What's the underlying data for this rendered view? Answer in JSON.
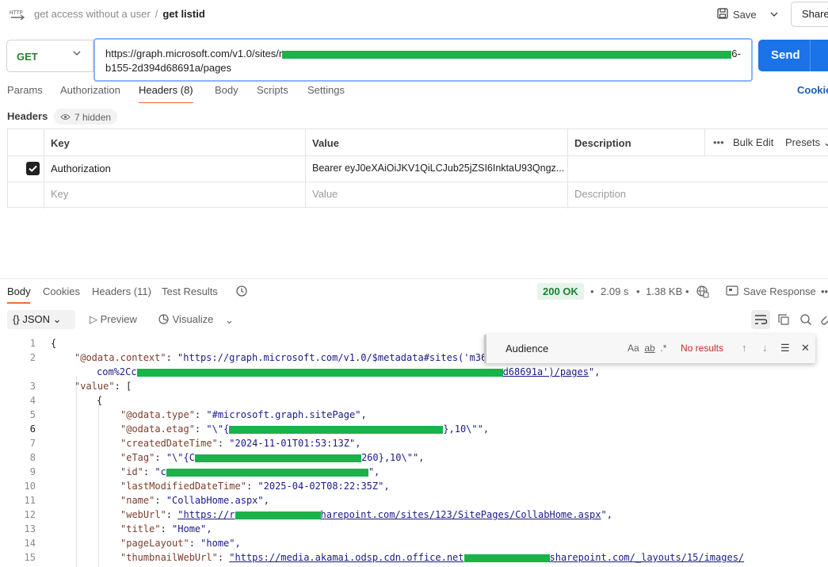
{
  "breadcrumb": {
    "parent": "get access without a user",
    "separator": "/",
    "current": "get listid"
  },
  "toolbar": {
    "save_label": "Save",
    "share_label": "Share"
  },
  "request": {
    "method": "GET",
    "url_line1_start": "https://graph.microsoft.com/v1.0/sites/r",
    "url_line1_end": "6-",
    "url_line2": "b155-2d394d68691a/pages",
    "send_label": "Send"
  },
  "request_tabs": [
    {
      "label": "Params"
    },
    {
      "label": "Authorization"
    },
    {
      "label": "Headers (8)"
    },
    {
      "label": "Body"
    },
    {
      "label": "Scripts"
    },
    {
      "label": "Settings"
    }
  ],
  "cookies_label": "Cookie",
  "headers_section": {
    "title": "Headers",
    "hidden_label": "7 hidden"
  },
  "headers_table": {
    "columns": {
      "key": "Key",
      "value": "Value",
      "description": "Description"
    },
    "bulk_edit": "Bulk Edit",
    "presets": "Presets",
    "rows": [
      {
        "key": "Authorization",
        "value": "Bearer eyJ0eXAiOiJKV1QiLCJub25jZSI6InktaU93Qngz...",
        "description": ""
      }
    ],
    "placeholders": {
      "key": "Key",
      "value": "Value",
      "description": "Description"
    }
  },
  "response_tabs": [
    {
      "label": "Body"
    },
    {
      "label": "Cookies"
    },
    {
      "label": "Headers (11)"
    },
    {
      "label": "Test Results"
    }
  ],
  "response_meta": {
    "status": "200 OK",
    "time": "2.09 s",
    "size": "1.38 KB",
    "save_label": "Save Response"
  },
  "response_toolbar": {
    "format": "JSON",
    "preview": "Preview",
    "visualize": "Visualize"
  },
  "find_widget": {
    "query": "Audience",
    "match_case": "Aa",
    "whole_word": "ab",
    "regex": ".*",
    "result": "No results"
  },
  "code": {
    "line_numbers": [
      "1",
      "2",
      "",
      "3",
      "4",
      "5",
      "6",
      "7",
      "8",
      "9",
      "10",
      "11",
      "12",
      "13",
      "14",
      "15"
    ],
    "l1": "{",
    "l2_key": "\"@odata.context\"",
    "l2_val_start": "\"https://graph.microsoft.com/v1.0/$metadata#sites('m36",
    "l2b_start": "com%2Cc",
    "l2b_end": "d68691a')/pages",
    "l2b_tail": "\",",
    "l3_key": "\"value\"",
    "l3_rest": ": [",
    "l4": "{",
    "l5_key": "\"@odata.type\"",
    "l5_val": "\"#microsoft.graph.sitePage\",",
    "l6_key": "\"@odata.etag\"",
    "l6_val_start": "\"\\\"{",
    "l6_val_end": "},10\\\"\",",
    "l7_key": "\"createdDateTime\"",
    "l7_val": "\"2024-11-01T01:53:13Z\",",
    "l8_key": "\"eTag\"",
    "l8_val_start": "\"\\\"{C",
    "l8_val_end": "260},10\\\"\",",
    "l9_key": "\"id\"",
    "l9_val_start": "\"c",
    "l9_val_end": "\",",
    "l10_key": "\"lastModifiedDateTime\"",
    "l10_val": "\"2025-04-02T08:22:35Z\",",
    "l11_key": "\"name\"",
    "l11_val": "\"CollabHome.aspx\",",
    "l12_key": "\"webUrl\"",
    "l12_val_start": "\"https://r",
    "l12_val_end": "harepoint.com/sites/123/SitePages/CollabHome.aspx",
    "l12_tail": "\",",
    "l13_key": "\"title\"",
    "l13_val": "\"Home\",",
    "l14_key": "\"pageLayout\"",
    "l14_val": "\"home\",",
    "l15_key": "\"thumbnailWebUrl\"",
    "l15_val_start": "\"https://media.akamai.odsp.cdn.office.net",
    "l15_val_end": "sharepoint.com/_layouts/15/images/"
  }
}
